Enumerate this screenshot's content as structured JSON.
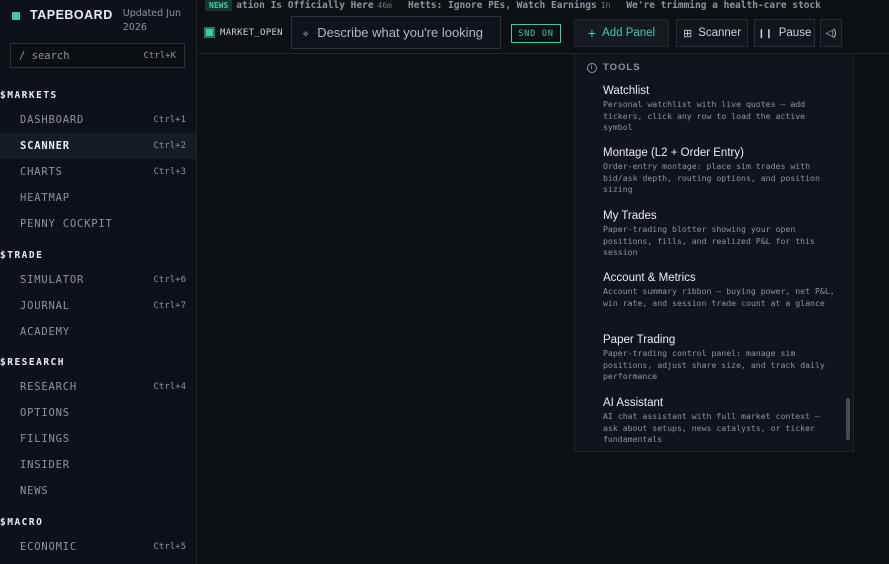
{
  "brand": {
    "name": "TAPEBOARD",
    "updated": "Updated Jun 2026"
  },
  "search": {
    "placeholder": "/ search",
    "shortcut": "Ctrl+K"
  },
  "sections": {
    "markets": "$MARKETS",
    "trade": "$TRADE",
    "research": "$RESEARCH",
    "macro": "$MACRO"
  },
  "nav": {
    "dashboard": {
      "label": "DASHBOARD",
      "shortcut": "Ctrl+1"
    },
    "scanner": {
      "label": "SCANNER",
      "shortcut": "Ctrl+2"
    },
    "charts": {
      "label": "CHARTS",
      "shortcut": "Ctrl+3"
    },
    "heatmap": {
      "label": "HEATMAP",
      "shortcut": ""
    },
    "penny": {
      "label": "PENNY COCKPIT",
      "shortcut": ""
    },
    "simulator": {
      "label": "SIMULATOR",
      "shortcut": "Ctrl+6"
    },
    "journal": {
      "label": "JOURNAL",
      "shortcut": "Ctrl+7"
    },
    "academy": {
      "label": "ACADEMY",
      "shortcut": ""
    },
    "research": {
      "label": "RESEARCH",
      "shortcut": "Ctrl+4"
    },
    "options": {
      "label": "OPTIONS",
      "shortcut": ""
    },
    "filings": {
      "label": "FILINGS",
      "shortcut": ""
    },
    "insider": {
      "label": "INSIDER",
      "shortcut": ""
    },
    "news": {
      "label": "NEWS",
      "shortcut": ""
    },
    "economic": {
      "label": "ECONOMIC",
      "shortcut": "Ctrl+5"
    }
  },
  "ticker": {
    "badge": "NEWS",
    "items": [
      {
        "text": "ation Is Officially Here",
        "age": "46m"
      },
      {
        "text": "Hetts: Ignore PEs, Watch Earnings",
        "age": "1h"
      },
      {
        "text": "We're trimming a health-care stock",
        "age": ""
      }
    ]
  },
  "topbar": {
    "market_status": "MARKET_OPEN",
    "ai_placeholder": "Describe what you're looking",
    "snd": "SND ON",
    "add_panel": "Add Panel",
    "scanner": "Scanner",
    "pause": "Pause"
  },
  "dropdown": {
    "header": "TOOLS",
    "items": [
      {
        "name": "Watchlist",
        "desc": "Personal watchlist with live quotes — add tickers, click any row to load the active symbol"
      },
      {
        "name": "Montage (L2 + Order Entry)",
        "desc": "Order-entry montage: place sim trades with bid/ask depth, routing options, and position sizing"
      },
      {
        "name": "My Trades",
        "desc": "Paper-trading blotter showing your open positions, fills, and realized P&L for this session"
      },
      {
        "name": "Account & Metrics",
        "desc": "Account summary ribbon — buying power, net P&L, win rate, and session trade count at a glance"
      },
      {
        "name": "Paper Trading",
        "desc": "Paper-trading control panel: manage sim positions, adjust share size, and track daily performance"
      },
      {
        "name": "AI Assistant",
        "desc": "AI chat assistant with full market context — ask about setups, news catalysts, or ticker fundamentals"
      }
    ]
  },
  "icons": {
    "spark": "sparkle-icon",
    "plus": "plus-icon",
    "grid": "grid-icon",
    "pause": "pause-icon",
    "sound": "speaker-icon",
    "info": "info-icon"
  },
  "colors": {
    "accent": "#3ec9a7",
    "background": "#0d1116"
  }
}
